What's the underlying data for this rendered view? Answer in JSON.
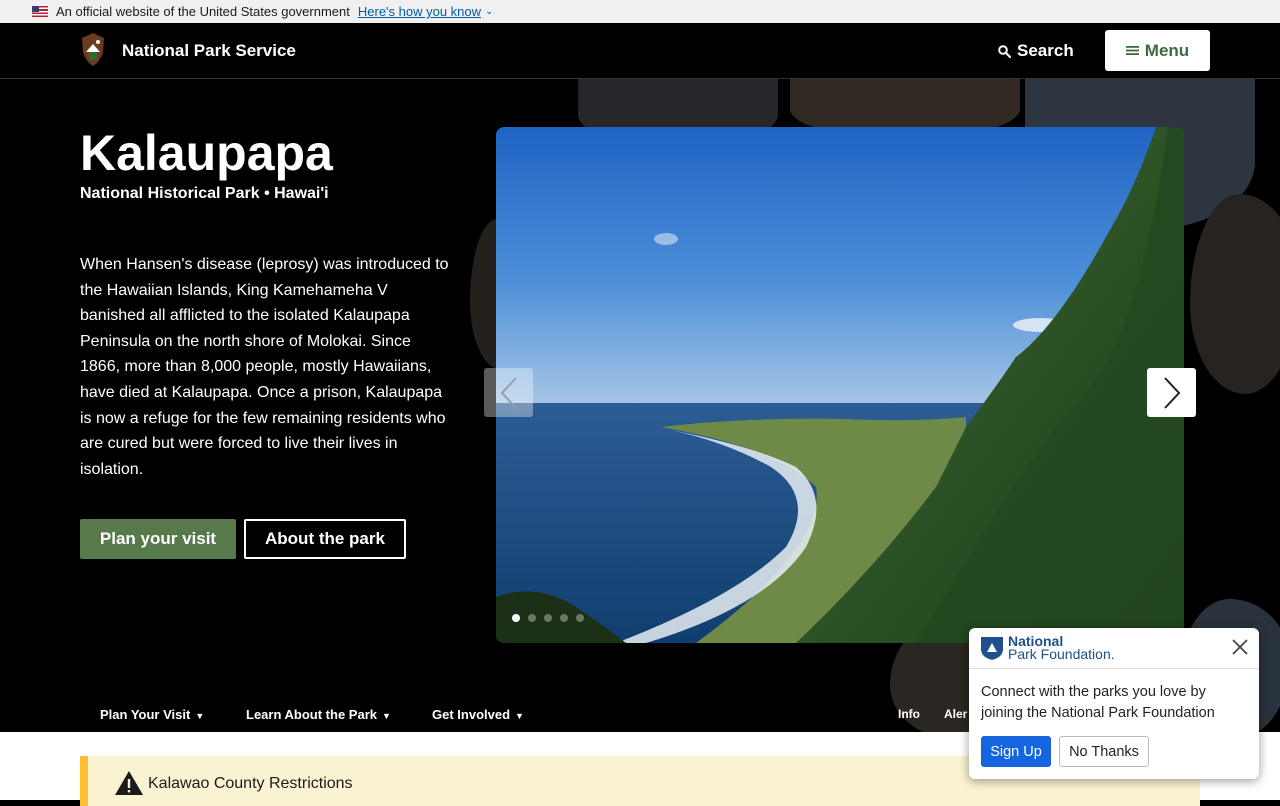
{
  "gov_banner": {
    "text": "An official website of the United States government",
    "link": "Here's how you know"
  },
  "header": {
    "brand": "National Park Service",
    "search_label": "Search",
    "menu_label": "Menu"
  },
  "hero": {
    "title": "Kalaupapa",
    "subtitle": "National Historical Park • Hawai'i",
    "description": "When Hansen's disease (leprosy) was introduced to the Hawaiian Islands, King Kamehameha V banished all afflicted to the isolated Kalaupapa Peninsula on the north shore of Molokai. Since 1866, more than 8,000 people, mostly Hawaiians, have died at Kalaupapa. Once a prison, Kalaupapa is now a refuge for the few remaining residents who are cured but were forced to live their lives in isolation.",
    "primary_button": "Plan your visit",
    "secondary_button": "About the park",
    "carousel_slide_count": 5,
    "carousel_active_index": 0
  },
  "subnav": {
    "items": [
      {
        "label": "Plan Your Visit"
      },
      {
        "label": "Learn About the Park"
      },
      {
        "label": "Get Involved"
      }
    ],
    "right_items": [
      {
        "label": "Info"
      },
      {
        "label": "Aler"
      }
    ]
  },
  "alert": {
    "text": "Kalawao County Restrictions"
  },
  "popup": {
    "logo_line1": "National",
    "logo_line2": "Park Foundation.",
    "message": "Connect with the parks you love by joining the National Park Foundation",
    "signup_label": "Sign Up",
    "decline_label": "No Thanks"
  },
  "colors": {
    "accent_green": "#577a4a",
    "menu_text": "#3d6b3f",
    "link_blue": "#005ea2",
    "alert_bg": "#faf3d1",
    "alert_border": "#ffbe2e",
    "signup_blue": "#1565e0"
  }
}
